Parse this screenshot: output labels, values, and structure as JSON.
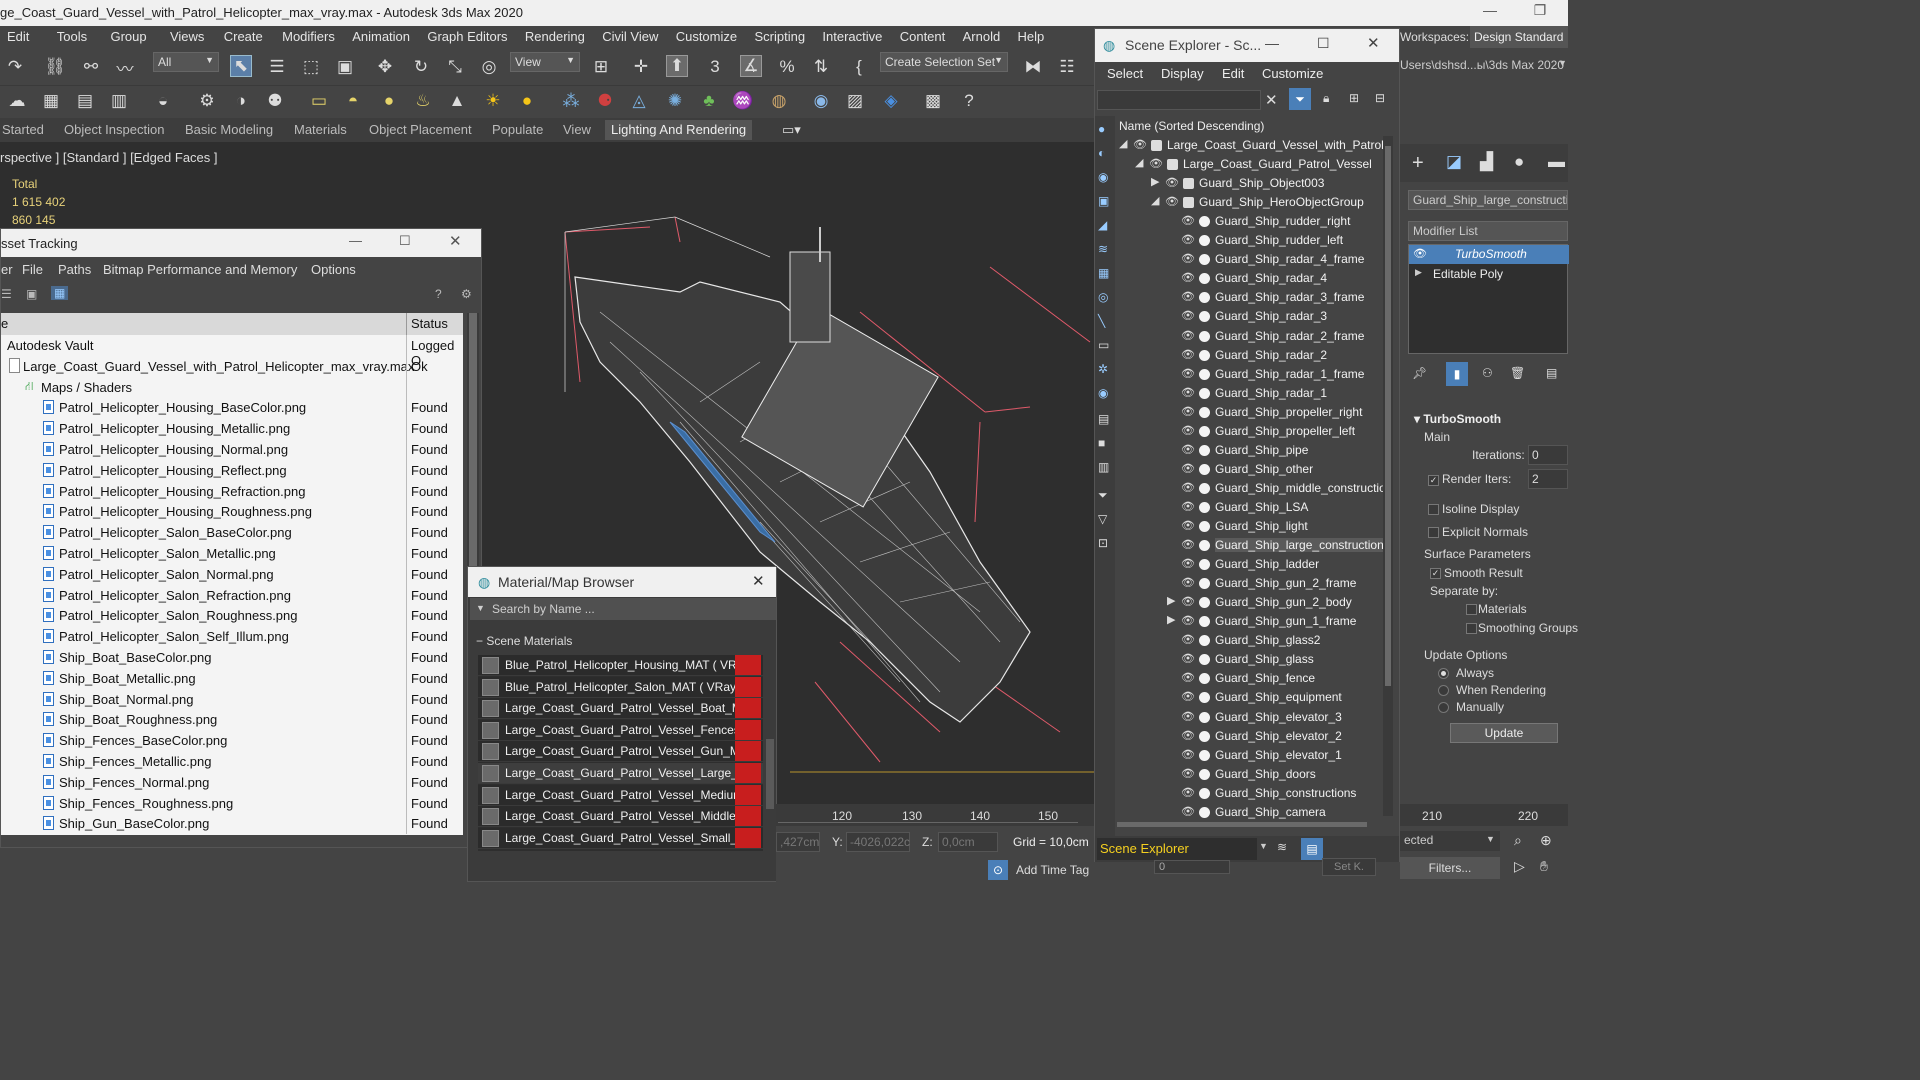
{
  "window": {
    "title": "ge_Coast_Guard_Vessel_with_Patrol_Helicopter_max_vray.max - Autodesk 3ds Max 2020"
  },
  "menubar": [
    "Edit",
    "Tools",
    "Group",
    "Views",
    "Create",
    "Modifiers",
    "Animation",
    "Graph Editors",
    "Rendering",
    "Civil View",
    "Customize",
    "Scripting",
    "Interactive",
    "Content",
    "Arnold",
    "Help"
  ],
  "toolbar": {
    "selection_filter": "All",
    "ref_coord": "View",
    "selection_set": "Create Selection Set"
  },
  "ribbon": {
    "tabs": [
      "Started",
      "Object Inspection",
      "Basic Modeling",
      "Materials",
      "Object Placement",
      "Populate",
      "View",
      "Lighting And Rendering"
    ],
    "active": "Lighting And Rendering"
  },
  "workspaces": {
    "label": "Workspaces:",
    "value": "Design Standard",
    "path": "Users\\dshsd...ы\\3ds Max 2020"
  },
  "viewport": {
    "label": "rspective ] [Standard ] [Edged Faces ]",
    "stats_label": "Total",
    "stats_polys": "1 615 402",
    "stats_verts": "860 145"
  },
  "asset_tracking": {
    "title": "sset Tracking",
    "menu": [
      "er",
      "File",
      "Paths",
      "Bitmap Performance and Memory",
      "Options"
    ],
    "col_name": "e",
    "col_status": "Status",
    "rows": [
      {
        "name": "Autodesk Vault",
        "status": "Logged O",
        "kind": "vault"
      },
      {
        "name": "Large_Coast_Guard_Vessel_with_Patrol_Helicopter_max_vray.max",
        "status": "Ok",
        "kind": "max"
      },
      {
        "name": "Maps / Shaders",
        "status": "",
        "kind": "folder"
      },
      {
        "name": "Patrol_Helicopter_Housing_BaseColor.png",
        "status": "Found",
        "kind": "file"
      },
      {
        "name": "Patrol_Helicopter_Housing_Metallic.png",
        "status": "Found",
        "kind": "file"
      },
      {
        "name": "Patrol_Helicopter_Housing_Normal.png",
        "status": "Found",
        "kind": "file"
      },
      {
        "name": "Patrol_Helicopter_Housing_Reflect.png",
        "status": "Found",
        "kind": "file"
      },
      {
        "name": "Patrol_Helicopter_Housing_Refraction.png",
        "status": "Found",
        "kind": "file"
      },
      {
        "name": "Patrol_Helicopter_Housing_Roughness.png",
        "status": "Found",
        "kind": "file"
      },
      {
        "name": "Patrol_Helicopter_Salon_BaseColor.png",
        "status": "Found",
        "kind": "file"
      },
      {
        "name": "Patrol_Helicopter_Salon_Metallic.png",
        "status": "Found",
        "kind": "file"
      },
      {
        "name": "Patrol_Helicopter_Salon_Normal.png",
        "status": "Found",
        "kind": "file"
      },
      {
        "name": "Patrol_Helicopter_Salon_Refraction.png",
        "status": "Found",
        "kind": "file"
      },
      {
        "name": "Patrol_Helicopter_Salon_Roughness.png",
        "status": "Found",
        "kind": "file"
      },
      {
        "name": "Patrol_Helicopter_Salon_Self_Illum.png",
        "status": "Found",
        "kind": "file"
      },
      {
        "name": "Ship_Boat_BaseColor.png",
        "status": "Found",
        "kind": "file"
      },
      {
        "name": "Ship_Boat_Metallic.png",
        "status": "Found",
        "kind": "file"
      },
      {
        "name": "Ship_Boat_Normal.png",
        "status": "Found",
        "kind": "file"
      },
      {
        "name": "Ship_Boat_Roughness.png",
        "status": "Found",
        "kind": "file"
      },
      {
        "name": "Ship_Fences_BaseColor.png",
        "status": "Found",
        "kind": "file"
      },
      {
        "name": "Ship_Fences_Metallic.png",
        "status": "Found",
        "kind": "file"
      },
      {
        "name": "Ship_Fences_Normal.png",
        "status": "Found",
        "kind": "file"
      },
      {
        "name": "Ship_Fences_Roughness.png",
        "status": "Found",
        "kind": "file"
      },
      {
        "name": "Ship_Gun_BaseColor.png",
        "status": "Found",
        "kind": "file"
      }
    ]
  },
  "material_browser": {
    "title": "Material/Map Browser",
    "search_placeholder": "Search by Name ...",
    "group": "Scene Materials",
    "items": [
      "Blue_Patrol_Helicopter_Housing_MAT  ( VRayM...",
      "Blue_Patrol_Helicopter_Salon_MAT  ( VRayMtl )...",
      "Large_Coast_Guard_Patrol_Vessel_Boat_MAT  (...",
      "Large_Coast_Guard_Patrol_Vessel_Fences_MA...",
      "Large_Coast_Guard_Patrol_Vessel_Gun_MAT  (...",
      "Large_Coast_Guard_Patrol_Vessel_Large_MAT...",
      "Large_Coast_Guard_Patrol_Vessel_Medium_MA...",
      "Large_Coast_Guard_Patrol_Vessel_Middle_MAT...",
      "Large_Coast_Guard_Patrol_Vessel_Small_MAT..."
    ]
  },
  "scene_explorer": {
    "title": "Scene Explorer - Sc...",
    "menu": [
      "Select",
      "Display",
      "Edit",
      "Customize"
    ],
    "column": "Name (Sorted Descending)",
    "footer": "Scene Explorer",
    "rows": [
      {
        "label": "Large_Coast_Guard_Vessel_with_Patrol_H",
        "level": 0,
        "exp": "open"
      },
      {
        "label": "Large_Coast_Guard_Patrol_Vessel",
        "level": 1,
        "exp": "open"
      },
      {
        "label": "Guard_Ship_Object003",
        "level": 2,
        "exp": "closed"
      },
      {
        "label": "Guard_Ship_HeroObjectGroup",
        "level": 2,
        "exp": "open"
      },
      {
        "label": "Guard_Ship_rudder_right",
        "level": 3,
        "exp": ""
      },
      {
        "label": "Guard_Ship_rudder_left",
        "level": 3,
        "exp": ""
      },
      {
        "label": "Guard_Ship_radar_4_frame",
        "level": 3,
        "exp": ""
      },
      {
        "label": "Guard_Ship_radar_4",
        "level": 3,
        "exp": ""
      },
      {
        "label": "Guard_Ship_radar_3_frame",
        "level": 3,
        "exp": ""
      },
      {
        "label": "Guard_Ship_radar_3",
        "level": 3,
        "exp": ""
      },
      {
        "label": "Guard_Ship_radar_2_frame",
        "level": 3,
        "exp": ""
      },
      {
        "label": "Guard_Ship_radar_2",
        "level": 3,
        "exp": ""
      },
      {
        "label": "Guard_Ship_radar_1_frame",
        "level": 3,
        "exp": ""
      },
      {
        "label": "Guard_Ship_radar_1",
        "level": 3,
        "exp": ""
      },
      {
        "label": "Guard_Ship_propeller_right",
        "level": 3,
        "exp": ""
      },
      {
        "label": "Guard_Ship_propeller_left",
        "level": 3,
        "exp": ""
      },
      {
        "label": "Guard_Ship_pipe",
        "level": 3,
        "exp": ""
      },
      {
        "label": "Guard_Ship_other",
        "level": 3,
        "exp": ""
      },
      {
        "label": "Guard_Ship_middle_construction",
        "level": 3,
        "exp": ""
      },
      {
        "label": "Guard_Ship_LSA",
        "level": 3,
        "exp": ""
      },
      {
        "label": "Guard_Ship_light",
        "level": 3,
        "exp": ""
      },
      {
        "label": "Guard_Ship_large_constructions",
        "level": 3,
        "exp": "",
        "selected": true
      },
      {
        "label": "Guard_Ship_ladder",
        "level": 3,
        "exp": ""
      },
      {
        "label": "Guard_Ship_gun_2_frame",
        "level": 3,
        "exp": ""
      },
      {
        "label": "Guard_Ship_gun_2_body",
        "level": 3,
        "exp": "closed"
      },
      {
        "label": "Guard_Ship_gun_1_frame",
        "level": 3,
        "exp": "closed"
      },
      {
        "label": "Guard_Ship_glass2",
        "level": 3,
        "exp": ""
      },
      {
        "label": "Guard_Ship_glass",
        "level": 3,
        "exp": ""
      },
      {
        "label": "Guard_Ship_fence",
        "level": 3,
        "exp": ""
      },
      {
        "label": "Guard_Ship_equipment",
        "level": 3,
        "exp": ""
      },
      {
        "label": "Guard_Ship_elevator_3",
        "level": 3,
        "exp": ""
      },
      {
        "label": "Guard_Ship_elevator_2",
        "level": 3,
        "exp": ""
      },
      {
        "label": "Guard_Ship_elevator_1",
        "level": 3,
        "exp": ""
      },
      {
        "label": "Guard_Ship_doors",
        "level": 3,
        "exp": ""
      },
      {
        "label": "Guard_Ship_constructions",
        "level": 3,
        "exp": ""
      },
      {
        "label": "Guard_Ship_camera",
        "level": 3,
        "exp": ""
      }
    ]
  },
  "command_panel": {
    "object_name": "Guard_Ship_large_construction",
    "modifier_list": "Modifier List",
    "stack": [
      "TurboSmooth",
      "Editable Poly"
    ],
    "rollout": "TurboSmooth",
    "main": "Main",
    "iterations_label": "Iterations:",
    "iterations_value": "0",
    "render_iters_label": "Render Iters:",
    "render_iters_value": "2",
    "isoline": "Isoline Display",
    "explicit_normals": "Explicit Normals",
    "surface_params": "Surface Parameters",
    "smooth_result": "Smooth Result",
    "separate_by": "Separate by:",
    "materials": "Materials",
    "smoothing_groups": "Smoothing Groups",
    "update_options": "Update Options",
    "always": "Always",
    "when_rendering": "When Rendering",
    "manually": "Manually",
    "update_button": "Update",
    "selected": "ected",
    "filters": "Filters..."
  },
  "timeline": {
    "ticks": [
      "120",
      "130",
      "140",
      "150",
      "210",
      "220"
    ]
  },
  "status": {
    "x_value": ",427cm",
    "y_label": "Y:",
    "y_value": "-4026,022c",
    "z_label": "Z:",
    "z_value": "0,0cm",
    "grid": "Grid = 10,0cm",
    "add_time_tag": "Add Time Tag",
    "set_k": "Set K.",
    "frame": "0"
  }
}
